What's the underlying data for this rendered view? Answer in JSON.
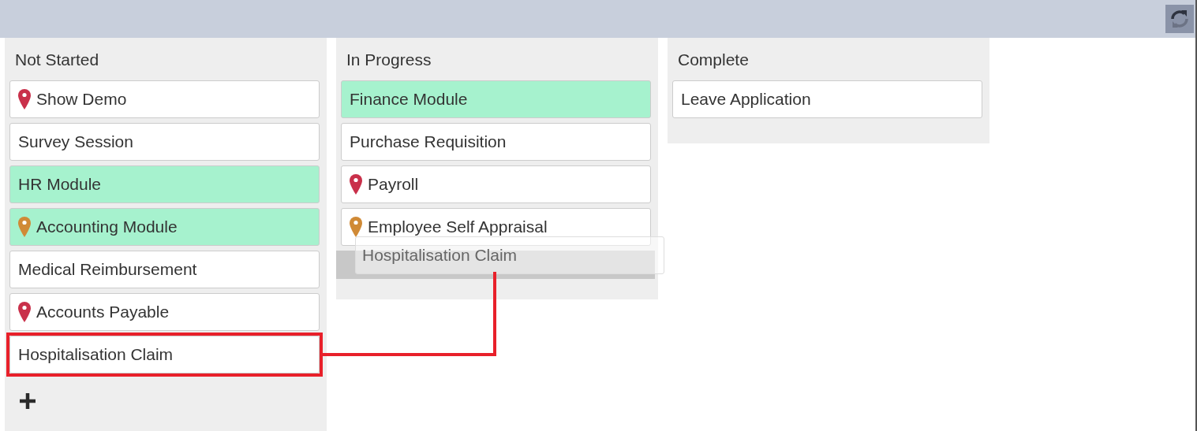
{
  "toolbar": {
    "refresh_button": {
      "kind": "refresh"
    }
  },
  "columns": [
    {
      "title": "Not Started",
      "drop_placeholder": false,
      "add_button": true,
      "cards": [
        {
          "text": "Show Demo",
          "highlighted": false,
          "marked": false,
          "color": "#c9304a"
        },
        {
          "text": "Survey Session",
          "highlighted": false,
          "marked": false
        },
        {
          "text": "HR Module",
          "highlighted": true,
          "marked": false
        },
        {
          "text": "Accounting Module",
          "highlighted": true,
          "marked": false,
          "color": "#d08a36"
        },
        {
          "text": "Medical Reimbursement",
          "highlighted": false,
          "marked": false
        },
        {
          "text": "Accounts Payable",
          "highlighted": false,
          "marked": false,
          "color": "#c9304a"
        },
        {
          "text": "Hospitalisation Claim",
          "highlighted": false,
          "marked": true
        }
      ]
    },
    {
      "title": "In Progress",
      "drop_placeholder": true,
      "add_button": false,
      "cards": [
        {
          "text": "Finance Module",
          "highlighted": true,
          "marked": false
        },
        {
          "text": "Purchase Requisition",
          "highlighted": false,
          "marked": false
        },
        {
          "text": "Payroll",
          "highlighted": false,
          "marked": false,
          "color": "#c9304a"
        },
        {
          "text": "Employee Self Appraisal",
          "highlighted": false,
          "marked": false,
          "color": "#d08a36"
        }
      ]
    },
    {
      "title": "Complete",
      "drop_placeholder": false,
      "add_button": false,
      "cards": [
        {
          "text": "Leave Application",
          "highlighted": false,
          "marked": false
        }
      ]
    }
  ],
  "drag_ghost": {
    "text": "Hospitalisation Claim"
  }
}
